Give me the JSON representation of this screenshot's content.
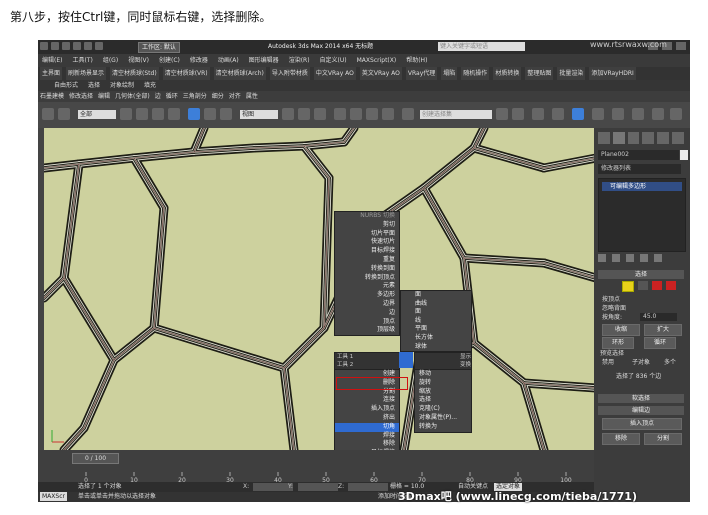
{
  "caption": "第八步，按住Ctrl键，同时鼠标右键，选择删除。",
  "window": {
    "workspace": "工作区: 默认",
    "title": "Autodesk 3ds Max 2014 x64    无标题",
    "search_placeholder": "键入关键字或短语"
  },
  "menubar": [
    "编辑(E)",
    "工具(T)",
    "组(G)",
    "视图(V)",
    "创建(C)",
    "修改器",
    "动画(A)",
    "图形编辑器",
    "渲染(R)",
    "自定义(U)",
    "MAXScript(X)",
    "帮助(H)"
  ],
  "plugins": [
    "主界面",
    "刷新场景显示",
    "清空材质球(Std)",
    "清空材质球(VR)",
    "清空材质球(Arch)",
    "导入附带材质",
    "中文VRay AO",
    "英文VRay AO",
    "VRay代理",
    "塌陷",
    "随机操作",
    "材质转换",
    "整理贴图",
    "批量渲染",
    "添加VRayHDRI"
  ],
  "ribbon": [
    "自由形式",
    "选择",
    "对象绘制",
    "填充"
  ],
  "ribbon2": [
    "石墨建模",
    "修改选择",
    "编辑",
    "几何体(全部)",
    "边",
    "循环",
    "三角剖分",
    "细分",
    "对齐",
    "属性"
  ],
  "toolbar": {
    "filter": "全部",
    "view": "视图",
    "named_sel": "创建选择集"
  },
  "quad_menu": {
    "top_left": [
      {
        "label": "NURBS 切换",
        "dis": true
      },
      {
        "label": "剪切",
        "dis": false
      },
      {
        "label": "切片平面",
        "dis": false
      },
      {
        "label": "快速切片",
        "dis": false
      },
      {
        "label": "目标焊接",
        "dis": false
      },
      {
        "label": "重复",
        "dis": false
      },
      {
        "label": "转换到面",
        "dis": false
      },
      {
        "label": "转换到顶点",
        "dis": false
      },
      {
        "label": "元素",
        "dis": false
      },
      {
        "label": "多边形",
        "dis": false
      },
      {
        "label": "边界",
        "dis": false
      },
      {
        "label": "边",
        "dis": false
      },
      {
        "label": "顶点",
        "dis": false
      },
      {
        "label": "顶层级",
        "dis": false
      }
    ],
    "label_tools1": "工具 1",
    "label_tools2": "工具 2",
    "label_display": "显示",
    "label_transform": "变换",
    "bottom_left": [
      {
        "label": "创建",
        "hl": false
      },
      {
        "label": "删除",
        "hl": false
      },
      {
        "label": "分割",
        "hl": false
      },
      {
        "label": "连接",
        "hl": false
      },
      {
        "label": "插入顶点",
        "hl": false
      },
      {
        "label": "挤出",
        "hl": false
      },
      {
        "label": "切角",
        "hl": true
      },
      {
        "label": "焊接",
        "hl": false
      },
      {
        "label": "移除",
        "hl": false
      },
      {
        "label": "目标焊接",
        "hl": false
      },
      {
        "label": "编辑三角剖分",
        "hl": false
      },
      {
        "label": "创建图形",
        "hl": false
      }
    ],
    "bottom_right": [
      "移动",
      "旋转",
      "缩放",
      "选择",
      "克隆(C)",
      "对象属性(P)...",
      "转换为"
    ],
    "submenu": [
      "面",
      "曲线",
      "面",
      "线",
      "平面",
      "长方体",
      "球体"
    ]
  },
  "cmdpanel": {
    "object_name": "Plane002",
    "modifier_list": "修改器列表",
    "stack_item": "可编辑多边形",
    "rollout_select": "选择",
    "by_vertex": "按顶点",
    "ignore_back": "忽略背面",
    "by_angle": "按角度:",
    "angle_val": "45.0",
    "shrink": "收缩",
    "grow": "扩大",
    "ring": "环形",
    "loop": "循环",
    "preview": "预览选择",
    "disable": "禁用",
    "subobj": "子对象",
    "multi": "多个",
    "selected_info": "选择了 836 个边",
    "soft_sel": "软选择",
    "edit_edges": "编辑边",
    "insert_vertex": "插入顶点",
    "remove": "移除",
    "split": "分割"
  },
  "timebar": {
    "frame": "0 / 100",
    "ticks": [
      "0",
      "10",
      "20",
      "30",
      "40",
      "50",
      "60",
      "70",
      "80",
      "90",
      "100"
    ]
  },
  "status": {
    "selected": "选择了 1 个对象",
    "hint": "单击或单击并拖动以选择对象",
    "x_label": "X:",
    "y_label": "Y:",
    "z_label": "Z:",
    "grid": "栅格 = 10.0",
    "autokey": "自动关键点",
    "set_key": "选定对象",
    "add_time": "添加时间标记",
    "maxscript": "MAXScr"
  },
  "watermark": "3Dmax吧 (www.linecg.com/tieba/1771)",
  "watermark2": "www.rtsrwaxw.com",
  "colors": {
    "highlight": "#2f6bd1",
    "viewport_bg": "#cdd19e",
    "selection_outline": "#d01010"
  }
}
